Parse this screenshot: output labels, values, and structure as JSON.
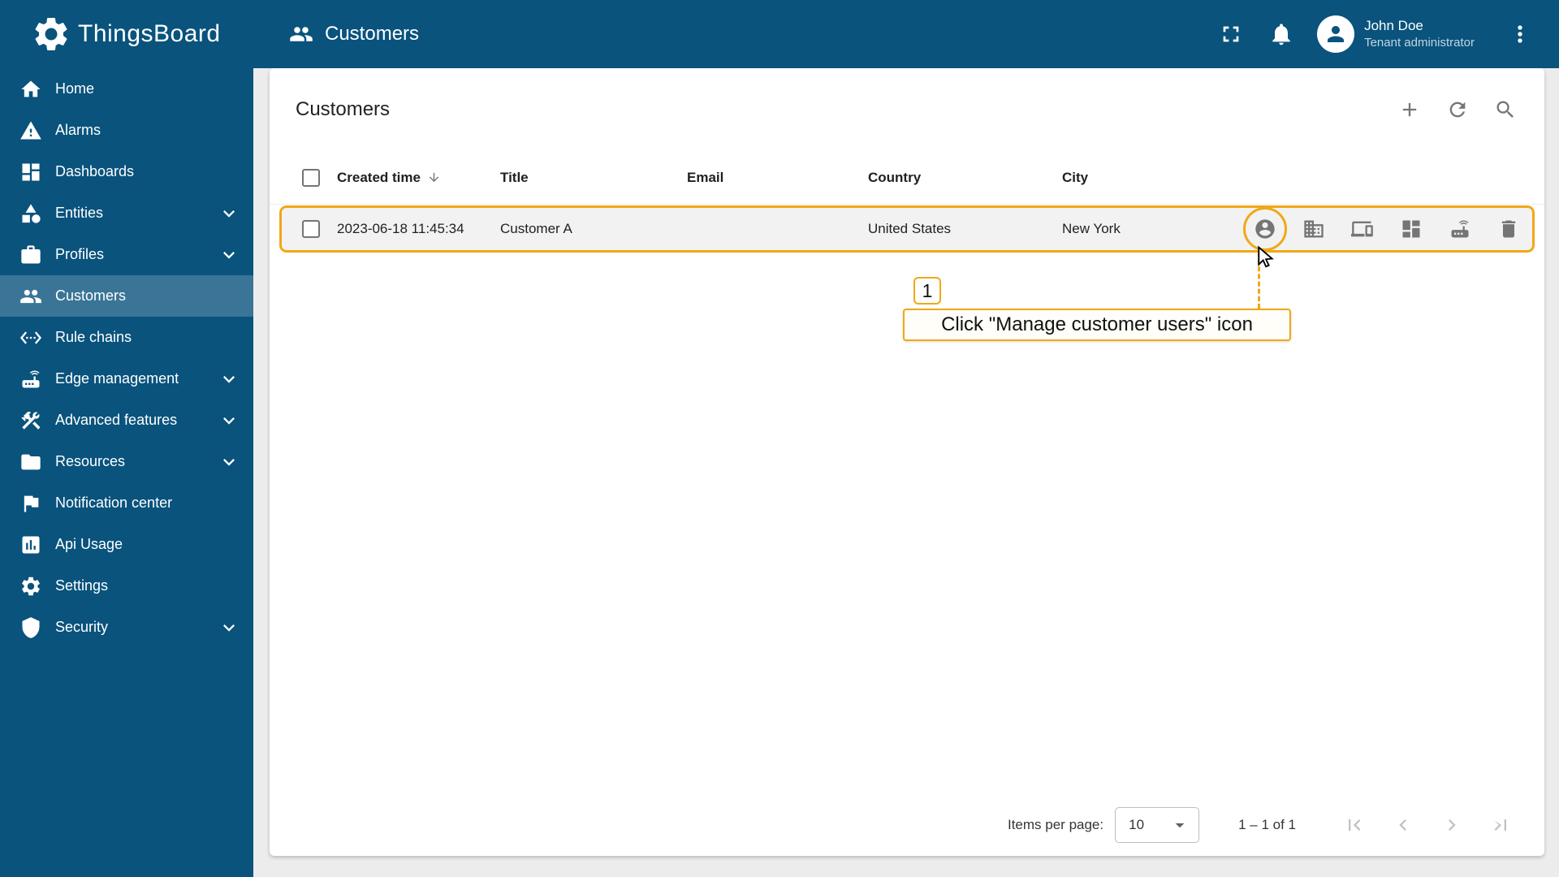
{
  "colors": {
    "primary": "#09537d",
    "accent_annotation": "#f0a817",
    "icon_gray": "#757575",
    "content_bg": "#ececec"
  },
  "sidebar": {
    "logo_text": "ThingsBoard",
    "items": [
      {
        "label": "Home",
        "icon": "home-icon",
        "expandable": false,
        "selected": false
      },
      {
        "label": "Alarms",
        "icon": "alarms-icon",
        "expandable": false,
        "selected": false
      },
      {
        "label": "Dashboards",
        "icon": "dashboards-icon",
        "expandable": false,
        "selected": false
      },
      {
        "label": "Entities",
        "icon": "entities-icon",
        "expandable": true,
        "selected": false
      },
      {
        "label": "Profiles",
        "icon": "profiles-icon",
        "expandable": true,
        "selected": false
      },
      {
        "label": "Customers",
        "icon": "customers-icon",
        "expandable": false,
        "selected": true
      },
      {
        "label": "Rule chains",
        "icon": "rule-chains-icon",
        "expandable": false,
        "selected": false
      },
      {
        "label": "Edge management",
        "icon": "edge-management-icon",
        "expandable": true,
        "selected": false
      },
      {
        "label": "Advanced features",
        "icon": "advanced-features-icon",
        "expandable": true,
        "selected": false
      },
      {
        "label": "Resources",
        "icon": "resources-icon",
        "expandable": true,
        "selected": false
      },
      {
        "label": "Notification center",
        "icon": "notification-center-icon",
        "expandable": false,
        "selected": false
      },
      {
        "label": "Api Usage",
        "icon": "api-usage-icon",
        "expandable": false,
        "selected": false
      },
      {
        "label": "Settings",
        "icon": "settings-icon",
        "expandable": false,
        "selected": false
      },
      {
        "label": "Security",
        "icon": "security-icon",
        "expandable": true,
        "selected": false
      }
    ]
  },
  "header": {
    "title": "Customers",
    "user": {
      "name": "John Doe",
      "role": "Tenant administrator"
    }
  },
  "main": {
    "card_title": "Customers",
    "table": {
      "columns": [
        "Created time",
        "Title",
        "Email",
        "Country",
        "City"
      ],
      "rows": [
        {
          "created_time": "2023-06-18 11:45:34",
          "title": "Customer A",
          "email": "",
          "country": "United States",
          "city": "New York",
          "actions": [
            "manage-customer-users",
            "manage-customer-assets",
            "manage-customer-devices",
            "manage-customer-dashboards",
            "manage-customer-edge-instances",
            "delete-customer"
          ]
        }
      ]
    },
    "pagination": {
      "items_per_page_label": "Items per page:",
      "items_per_page_value": "10",
      "range_label": "1 – 1 of 1"
    }
  },
  "annotation": {
    "step_number": "1",
    "callout_text": "Click \"Manage customer users\" icon"
  }
}
